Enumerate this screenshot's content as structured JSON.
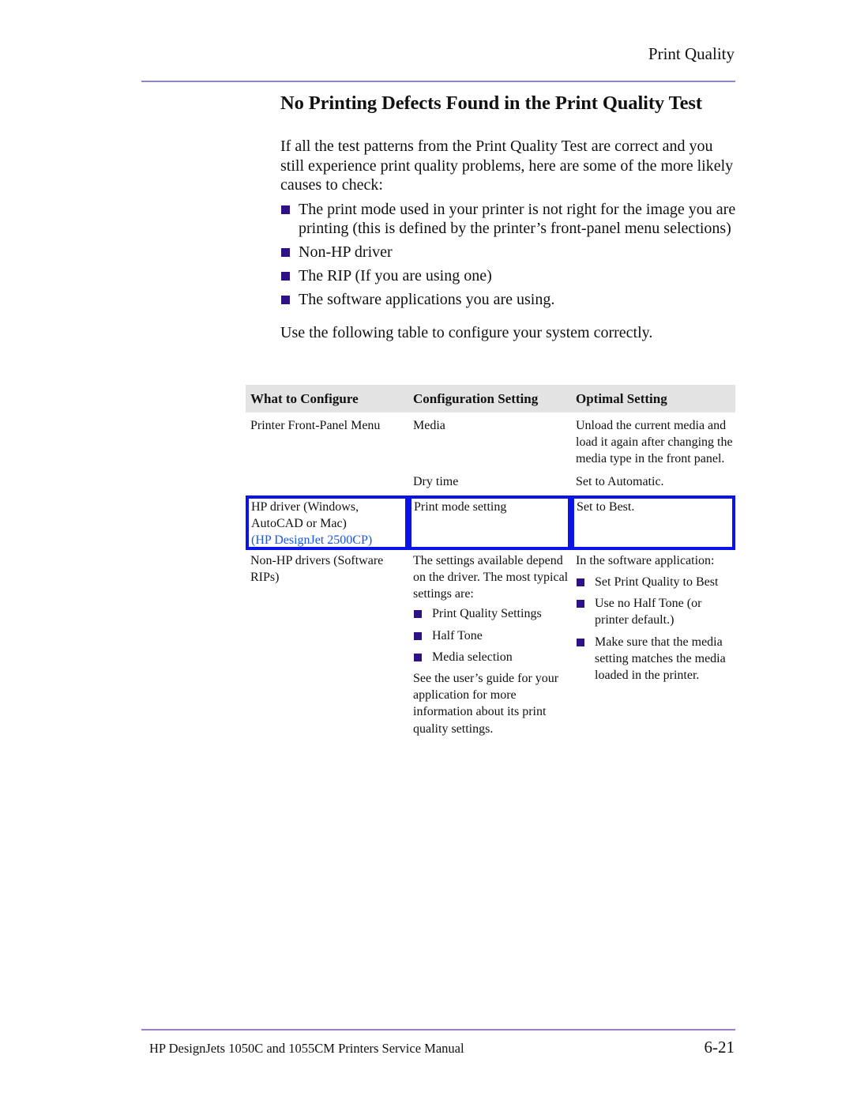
{
  "header": {
    "running_head": "Print Quality"
  },
  "section": {
    "title": "No Printing Defects Found in the Print Quality Test",
    "intro": "If all the test patterns from the Print Quality Test are correct and you still experience print quality problems, here are some of the more likely causes to check:",
    "bullets": [
      "The print mode used in your printer is not right for the image you are printing (this is defined by the printer’s front-panel menu selections)",
      "Non-HP driver",
      "The RIP (If you are using one)",
      "The software applications you are using."
    ],
    "table_intro": "Use the following table to configure your system correctly."
  },
  "table": {
    "headers": [
      "What to Configure",
      "Configuration Setting",
      "Optimal Setting"
    ],
    "rows": [
      {
        "what": "Printer Front-Panel Menu",
        "setting": "Media",
        "optimal": "Unload the current media and load it again after changing the media type in the front panel."
      },
      {
        "what": "",
        "setting": "Dry time",
        "optimal": "Set to Automatic."
      },
      {
        "what": "HP driver (Windows, AutoCAD or Mac)",
        "what_note": "(HP DesignJet 2500CP)",
        "setting": "Print mode setting",
        "optimal": "Set to Best.",
        "highlighted": true
      },
      {
        "what": "Non-HP drivers (Software RIPs)",
        "setting": "The settings available depend on the driver. The most typical settings are:",
        "setting_bullets": [
          "Print Quality Settings",
          "Half Tone",
          "Media selection"
        ],
        "setting_note": "See the user’s guide for your application for more information about its print quality settings.",
        "optimal": "In the software application:",
        "optimal_bullets": [
          "Set Print Quality to Best",
          "Use no Half Tone (or printer default.)",
          "Make sure that the media setting matches the media loaded in the printer."
        ]
      }
    ]
  },
  "footer": {
    "manual_title": "HP DesignJets 1050C and 1055CM Printers Service Manual",
    "page_number": "6-21"
  },
  "colors": {
    "bullet": "#2e1184",
    "highlight_border": "#0a14e8",
    "highlight_link": "#1b56e6",
    "header_rule": "#8c88c4",
    "footer_rule": "#a07cc8",
    "table_header_bg": "#e3e3e3"
  }
}
